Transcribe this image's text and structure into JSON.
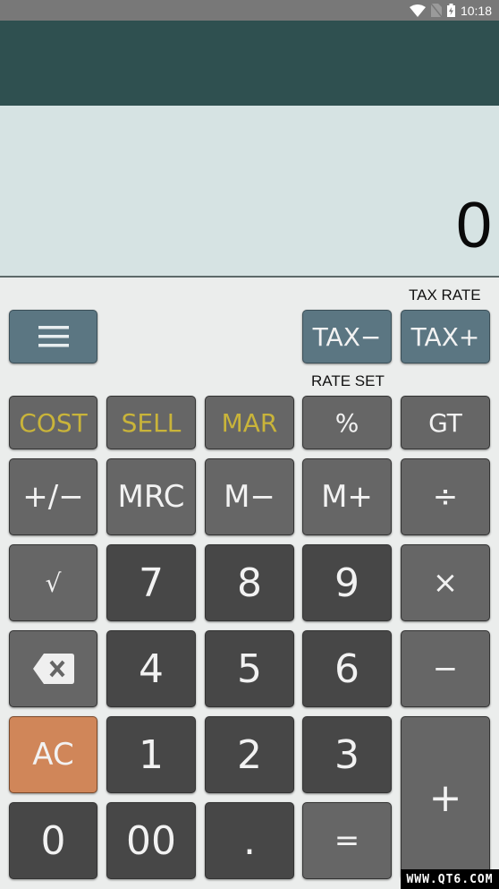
{
  "status_bar": {
    "time": "10:18",
    "icons": [
      "wifi-icon",
      "no-sim-icon",
      "battery-charging-icon"
    ]
  },
  "display": {
    "value": "0"
  },
  "labels": {
    "tax_rate": "TAX RATE",
    "rate_set": "RATE SET"
  },
  "top_controls": {
    "menu_icon": "hamburger-menu-icon",
    "tax_minus": "TAX−",
    "tax_plus": "TAX+"
  },
  "keypad": {
    "row1": [
      "COST",
      "SELL",
      "MAR",
      "%",
      "GT"
    ],
    "row2": [
      "+/−",
      "MRC",
      "M−",
      "M+",
      "÷"
    ],
    "row3": [
      "√",
      "7",
      "8",
      "9",
      "×"
    ],
    "row4": [
      "backspace-icon",
      "4",
      "5",
      "6",
      "−"
    ],
    "row5": [
      "AC",
      "1",
      "2",
      "3",
      "+"
    ],
    "row6": [
      "0",
      "00",
      ".",
      "="
    ]
  },
  "colors": {
    "app_bar": "#2f5050",
    "display_bg": "#d6e3e3",
    "tax_button": "#5b7682",
    "function_key": "#666666",
    "digit_key": "#474747",
    "clear_key": "#d08659",
    "margin_text": "#c9b43a"
  },
  "watermark": "WWW.QT6.COM"
}
